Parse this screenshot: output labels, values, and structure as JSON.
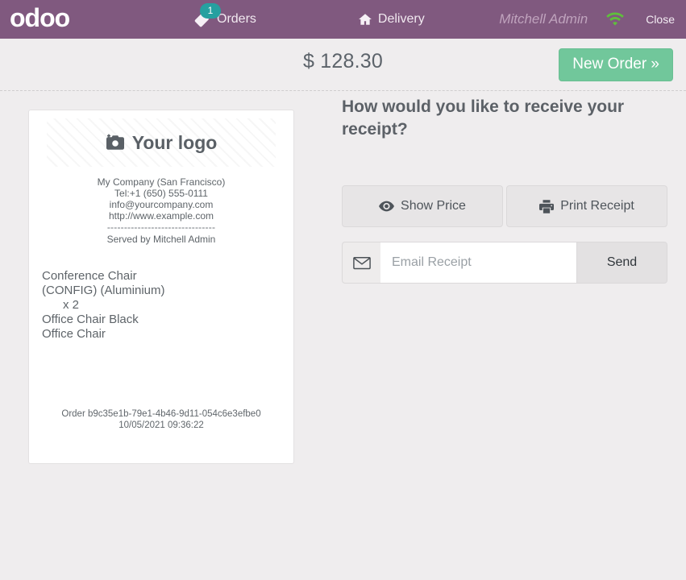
{
  "topbar": {
    "brand": "odoo",
    "orders": {
      "label": "Orders",
      "badge": "1",
      "icon": "tag-icon"
    },
    "delivery": {
      "label": "Delivery",
      "icon": "home-icon"
    },
    "username": "Mitchell Admin",
    "wifi_icon": "wifi-icon",
    "close_label": "Close",
    "bar_color": "#80597f",
    "badge_color": "#26a0a0",
    "wifi_color": "#5fbf3c"
  },
  "subheader": {
    "order_total": "$ 128.30",
    "new_order_label": "New Order »",
    "new_order_color": "#71c79b"
  },
  "receipt": {
    "logo_placeholder": "Your logo",
    "logo_icon": "camera-icon",
    "company": {
      "name": "My Company (San Francisco)",
      "phone": "Tel:+1 (650) 555-0111",
      "email": "info@yourcompany.com",
      "website": "http://www.example.com",
      "divider": "--------------------------------",
      "served_by": "Served by Mitchell Admin"
    },
    "orderlines": [
      "Conference Chair",
      "(CONFIG) (Aluminium)",
      "x 2",
      "Office Chair Black",
      "Office Chair"
    ],
    "footer": {
      "order_ref": "Order b9c35e1b-79e1-4b46-9d11-054c6e3efbe0",
      "datetime": "10/05/2021 09:36:22"
    }
  },
  "panel": {
    "question": "How would you like to receive your receipt?",
    "show_price_label": "Show Price",
    "show_price_icon": "eye-icon",
    "print_receipt_label": "Print Receipt",
    "print_receipt_icon": "printer-icon",
    "email_icon": "envelope-icon",
    "email_placeholder": "Email Receipt",
    "email_value": "",
    "send_label": "Send"
  }
}
